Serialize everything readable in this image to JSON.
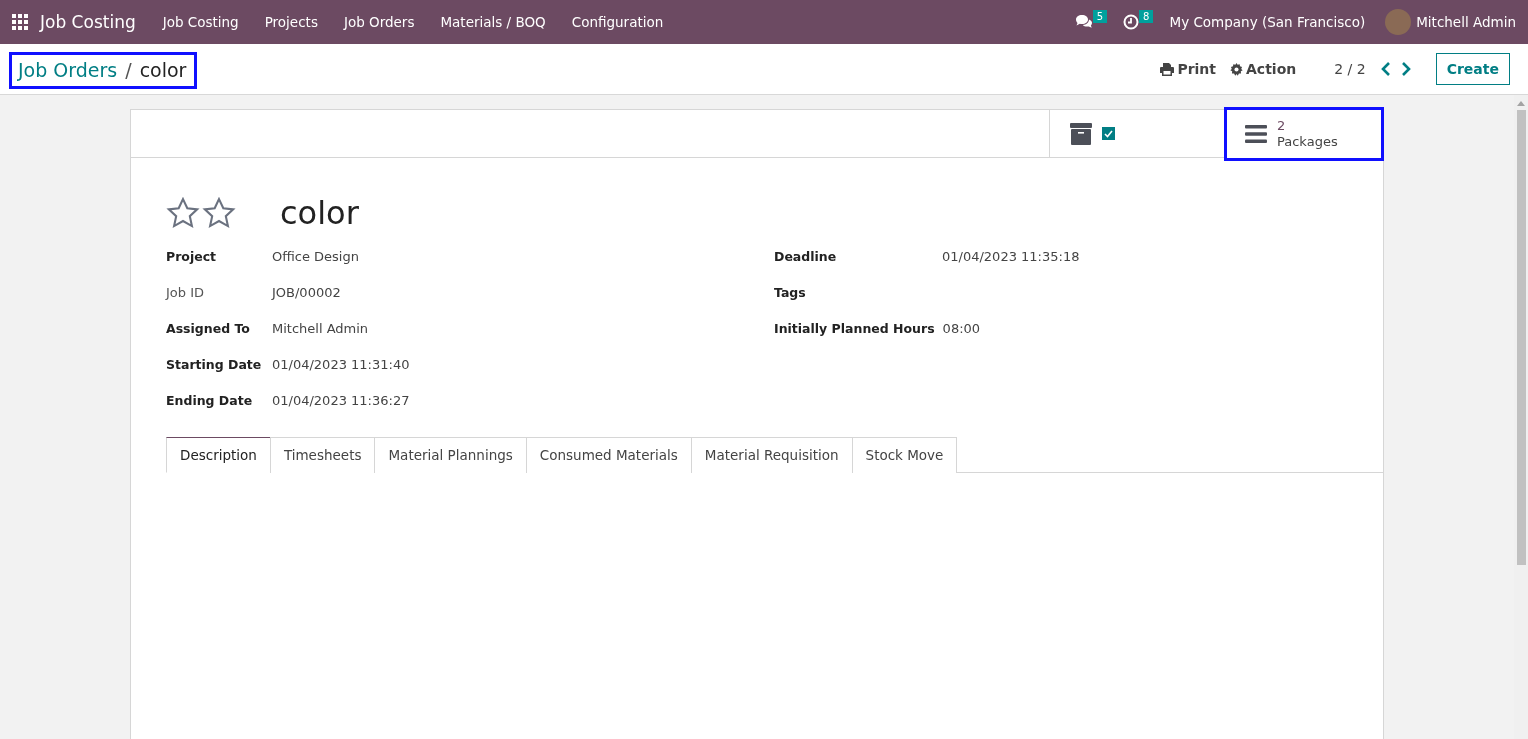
{
  "navbar": {
    "app_name": "Job Costing",
    "menu": [
      "Job Costing",
      "Projects",
      "Job Orders",
      "Materials / BOQ",
      "Configuration"
    ],
    "messages_count": "5",
    "activities_count": "8",
    "company": "My Company (San Francisco)",
    "user": "Mitchell Admin"
  },
  "control_panel": {
    "breadcrumb": "Job Orders",
    "separator": "/",
    "current": "color",
    "print": "Print",
    "action": "Action",
    "pager": "2 / 2",
    "create": "Create"
  },
  "button_box": {
    "archive_checked": true,
    "packages_count": "2",
    "packages_label": "Packages"
  },
  "record": {
    "priority": [
      {
        "on": false
      },
      {
        "on": false
      }
    ],
    "title": "color"
  },
  "left_fields": [
    {
      "label": "Project",
      "value": "Office Design",
      "kind": "bold"
    },
    {
      "label": "Job ID",
      "value": "JOB/00002",
      "kind": "plain"
    },
    {
      "label": "Assigned To",
      "value": "Mitchell Admin",
      "kind": "bold"
    },
    {
      "label": "Starting Date",
      "value": "01/04/2023 11:31:40",
      "kind": "bold"
    },
    {
      "label": "Ending Date",
      "value": "01/04/2023 11:36:27",
      "kind": "bold"
    }
  ],
  "right_fields": [
    {
      "label": "Deadline",
      "value": "01/04/2023 11:35:18",
      "kind": "bold"
    },
    {
      "label": "Tags",
      "kind": "bold"
    },
    {
      "label": "Initially Planned Hours",
      "value": "08:00",
      "kind": "bold"
    }
  ],
  "tabs": [
    {
      "label": "Description",
      "selected": true
    },
    {
      "label": "Timesheets",
      "selected": false
    },
    {
      "label": "Material Plannings",
      "selected": false
    },
    {
      "label": "Consumed Materials",
      "selected": false
    },
    {
      "label": "Material Requisition",
      "selected": false
    },
    {
      "label": "Stock Move",
      "selected": false
    }
  ]
}
